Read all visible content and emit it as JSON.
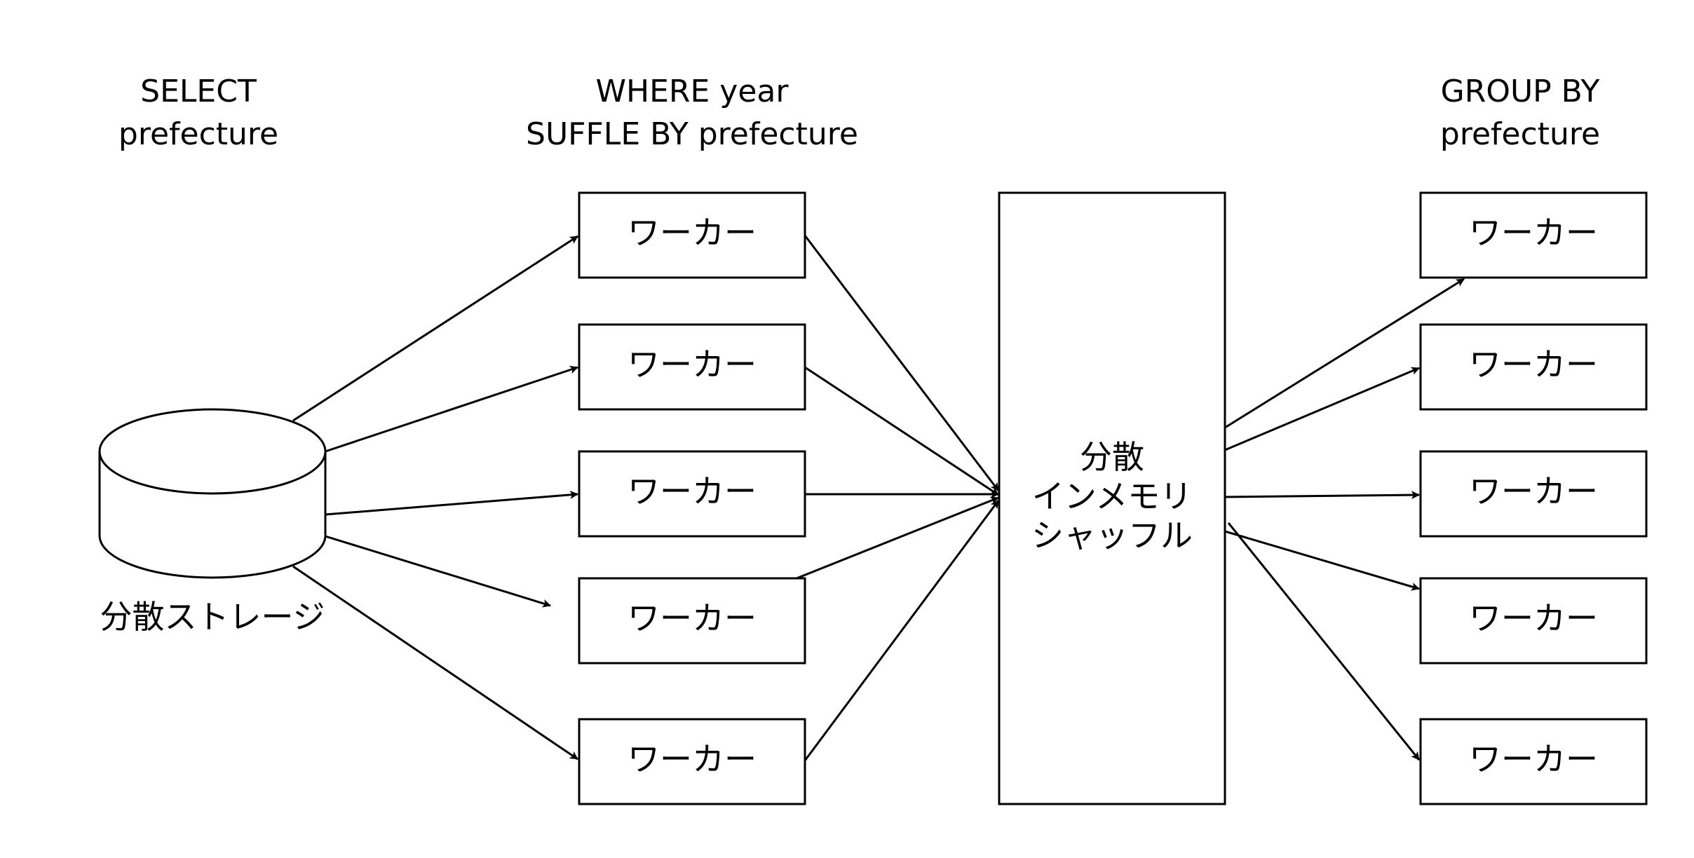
{
  "headings": {
    "select": [
      "SELECT",
      "prefecture"
    ],
    "where": [
      "WHERE year",
      "SUFFLE BY prefecture"
    ],
    "group": [
      "GROUP BY",
      "prefecture"
    ]
  },
  "storage": {
    "label": "分散ストレージ"
  },
  "workers_stage1": [
    {
      "label": "ワーカー"
    },
    {
      "label": "ワーカー"
    },
    {
      "label": "ワーカー"
    },
    {
      "label": "ワーカー"
    },
    {
      "label": "ワーカー"
    }
  ],
  "shuffle": {
    "lines": [
      "分散",
      "インメモリ",
      "シャッフル"
    ]
  },
  "workers_stage2": [
    {
      "label": "ワーカー"
    },
    {
      "label": "ワーカー"
    },
    {
      "label": "ワーカー"
    },
    {
      "label": "ワーカー"
    },
    {
      "label": "ワーカー"
    }
  ]
}
